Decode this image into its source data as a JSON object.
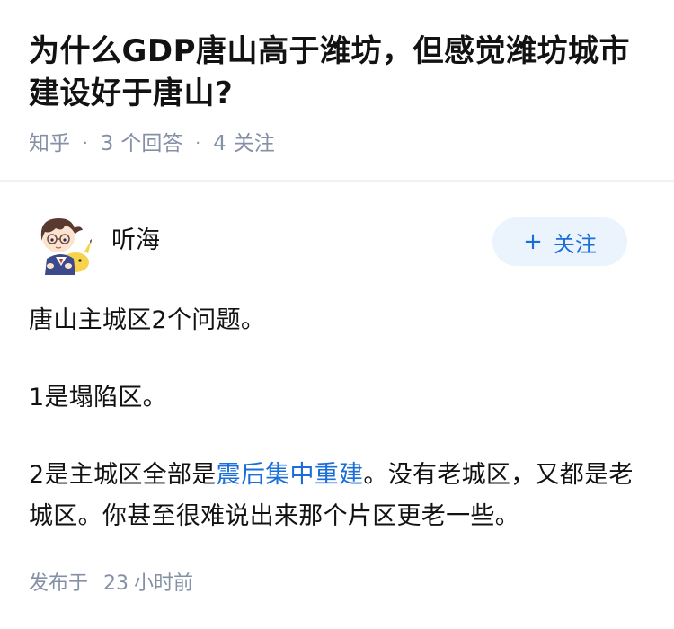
{
  "question": {
    "title": "为什么GDP唐山高于潍坊，但感觉潍坊城市建设好于唐山?",
    "source": "知乎",
    "separator": "·",
    "answers_count": "3",
    "answers_label": "个回答",
    "followers_count": "4",
    "followers_label": "关注"
  },
  "author": {
    "name": "听海",
    "avatar_icon": "anime-avatar-icon",
    "follow_label": "关注",
    "follow_icon": "plus-icon"
  },
  "answer": {
    "paragraph_1": "唐山主城区2个问题。",
    "paragraph_2": "1是塌陷区。",
    "paragraph_3_prefix": "2是主城区全部是",
    "paragraph_3_link": "震后集中重建",
    "paragraph_3_suffix": "。没有老城区，又都是老城区。你甚至很难说出来那个片区更老一些。"
  },
  "publish": {
    "label": "发布于",
    "time_value": "23",
    "time_unit": "小时前"
  },
  "colors": {
    "accent": "#1a6ed8",
    "follow_bg": "#ebf3fc",
    "meta_gray": "#8590a6",
    "text": "#121212"
  }
}
